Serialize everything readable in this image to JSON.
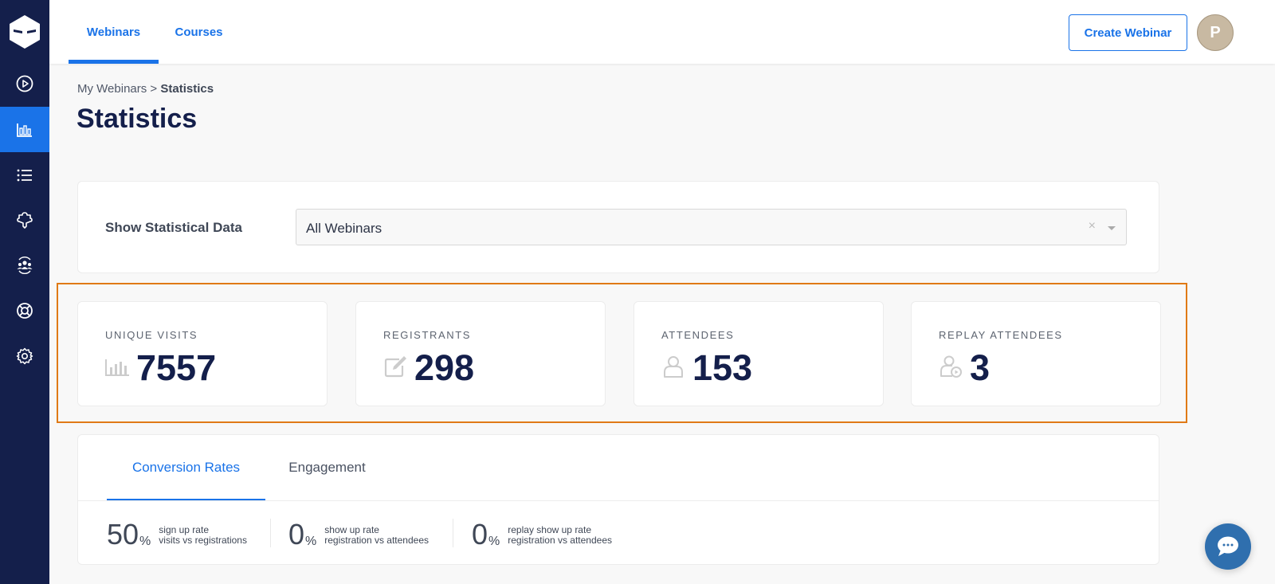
{
  "sidebar": {
    "logo": "ninja-logo",
    "items": [
      {
        "name": "webinars-play",
        "icon": "play-circle-icon",
        "active": false
      },
      {
        "name": "statistics",
        "icon": "bar-chart-icon",
        "active": true
      },
      {
        "name": "list",
        "icon": "list-icon",
        "active": false
      },
      {
        "name": "integrations",
        "icon": "puzzle-icon",
        "active": false
      },
      {
        "name": "community",
        "icon": "users-icon",
        "active": false
      },
      {
        "name": "support",
        "icon": "lifebuoy-icon",
        "active": false
      },
      {
        "name": "settings",
        "icon": "gear-icon",
        "active": false
      }
    ]
  },
  "topbar": {
    "tabs": [
      {
        "label": "Webinars",
        "active": true
      },
      {
        "label": "Courses",
        "active": false
      }
    ],
    "create_button": "Create Webinar",
    "avatar_initial": "P"
  },
  "breadcrumb": {
    "parent": "My Webinars",
    "separator": ">",
    "current": "Statistics"
  },
  "page_title": "Statistics",
  "filter": {
    "label": "Show Statistical Data",
    "selected": "All Webinars",
    "clear": "×"
  },
  "stats": [
    {
      "label": "UNIQUE VISITS",
      "value": "7557",
      "icon": "bar-chart-icon"
    },
    {
      "label": "REGISTRANTS",
      "value": "298",
      "icon": "edit-icon"
    },
    {
      "label": "ATTENDEES",
      "value": "153",
      "icon": "user-icon"
    },
    {
      "label": "REPLAY ATTENDEES",
      "value": "3",
      "icon": "user-replay-icon"
    }
  ],
  "details": {
    "tabs": [
      {
        "label": "Conversion Rates",
        "active": true
      },
      {
        "label": "Engagement",
        "active": false
      }
    ],
    "rates": [
      {
        "value": "50",
        "unit": "%",
        "title": "sign up rate",
        "subtitle": "visits vs registrations"
      },
      {
        "value": "0",
        "unit": "%",
        "title": "show up rate",
        "subtitle": "registration vs attendees"
      },
      {
        "value": "0",
        "unit": "%",
        "title": "replay show up rate",
        "subtitle": "registration vs attendees"
      }
    ]
  },
  "colors": {
    "sidebar": "#141f4b",
    "accent": "#1a73e8",
    "highlight": "#e07a16",
    "chat": "#2f6fae"
  }
}
